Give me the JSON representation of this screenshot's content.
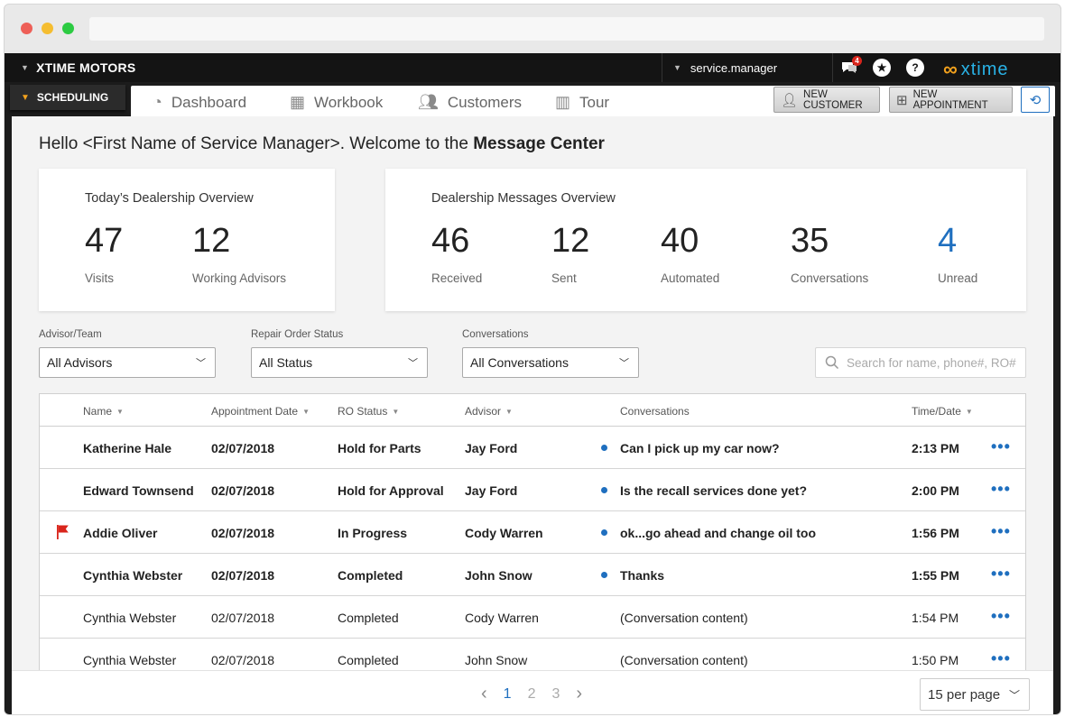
{
  "app": {
    "brand": "XTIME MOTORS",
    "module": "SCHEDULING",
    "user": "service.manager",
    "notification_count": "4",
    "logo_text": "xtime",
    "colors": {
      "accent": "#1f6fbf",
      "brand_orange": "#f4a21d",
      "logo_blue": "#29b2e6",
      "flag_red": "#d9251c"
    }
  },
  "tabs": [
    {
      "label": "Dashboard",
      "icon": "gauge-icon"
    },
    {
      "label": "Workbook",
      "icon": "calendar-icon"
    },
    {
      "label": "Customers",
      "icon": "people-icon"
    },
    {
      "label": "Tour",
      "icon": "map-icon"
    }
  ],
  "actions": {
    "new_customer": "NEW CUSTOMER",
    "new_appointment": "NEW APPOINTMENT"
  },
  "greeting": {
    "prefix": "Hello <First Name of Service Manager>. Welcome to the ",
    "emphasis": "Message Center"
  },
  "dealership_overview": {
    "title": "Today’s Dealership Overview",
    "stats": [
      {
        "value": "47",
        "label": "Visits"
      },
      {
        "value": "12",
        "label": "Working Advisors"
      }
    ]
  },
  "messages_overview": {
    "title": "Dealership Messages Overview",
    "stats": [
      {
        "value": "46",
        "label": "Received"
      },
      {
        "value": "12",
        "label": "Sent"
      },
      {
        "value": "40",
        "label": "Automated"
      },
      {
        "value": "35",
        "label": "Conversations"
      },
      {
        "value": "4",
        "label": "Unread"
      }
    ]
  },
  "filters": {
    "advisor": {
      "label": "Advisor/Team",
      "value": "All Advisors"
    },
    "ro_status": {
      "label": "Repair Order Status",
      "value": "All Status"
    },
    "conversations": {
      "label": "Conversations",
      "value": "All Conversations"
    },
    "search_placeholder": "Search for name, phone#, RO#"
  },
  "table": {
    "headers": {
      "name": "Name",
      "appointment_date": "Appointment Date",
      "ro_status": "RO Status",
      "advisor": "Advisor",
      "conversations": "Conversations",
      "time": "Time/Date"
    },
    "rows": [
      {
        "flag": false,
        "unread": true,
        "name": "Katherine Hale",
        "date": "02/07/2018",
        "status": "Hold for Parts",
        "advisor": "Jay Ford",
        "message": "Can I pick up my car now?",
        "time": "2:13 PM"
      },
      {
        "flag": false,
        "unread": true,
        "name": "Edward Townsend",
        "date": "02/07/2018",
        "status": "Hold for Approval",
        "advisor": "Jay Ford",
        "message": "Is the recall services done yet?",
        "time": "2:00 PM"
      },
      {
        "flag": true,
        "unread": true,
        "name": "Addie Oliver",
        "date": "02/07/2018",
        "status": "In Progress",
        "advisor": "Cody Warren",
        "message": "ok...go ahead and change oil too",
        "time": "1:56 PM"
      },
      {
        "flag": false,
        "unread": true,
        "name": "Cynthia Webster",
        "date": "02/07/2018",
        "status": "Completed",
        "advisor": "John Snow",
        "message": "Thanks",
        "time": "1:55 PM"
      },
      {
        "flag": false,
        "unread": false,
        "name": "Cynthia Webster",
        "date": "02/07/2018",
        "status": "Completed",
        "advisor": "Cody Warren",
        "message": "(Conversation content)",
        "time": "1:54 PM"
      },
      {
        "flag": false,
        "unread": false,
        "name": "Cynthia Webster",
        "date": "02/07/2018",
        "status": "Completed",
        "advisor": "John Snow",
        "message": "(Conversation content)",
        "time": "1:50 PM"
      }
    ]
  },
  "pagination": {
    "pages": [
      "1",
      "2",
      "3"
    ],
    "current": "1",
    "per_page": "15 per page"
  }
}
